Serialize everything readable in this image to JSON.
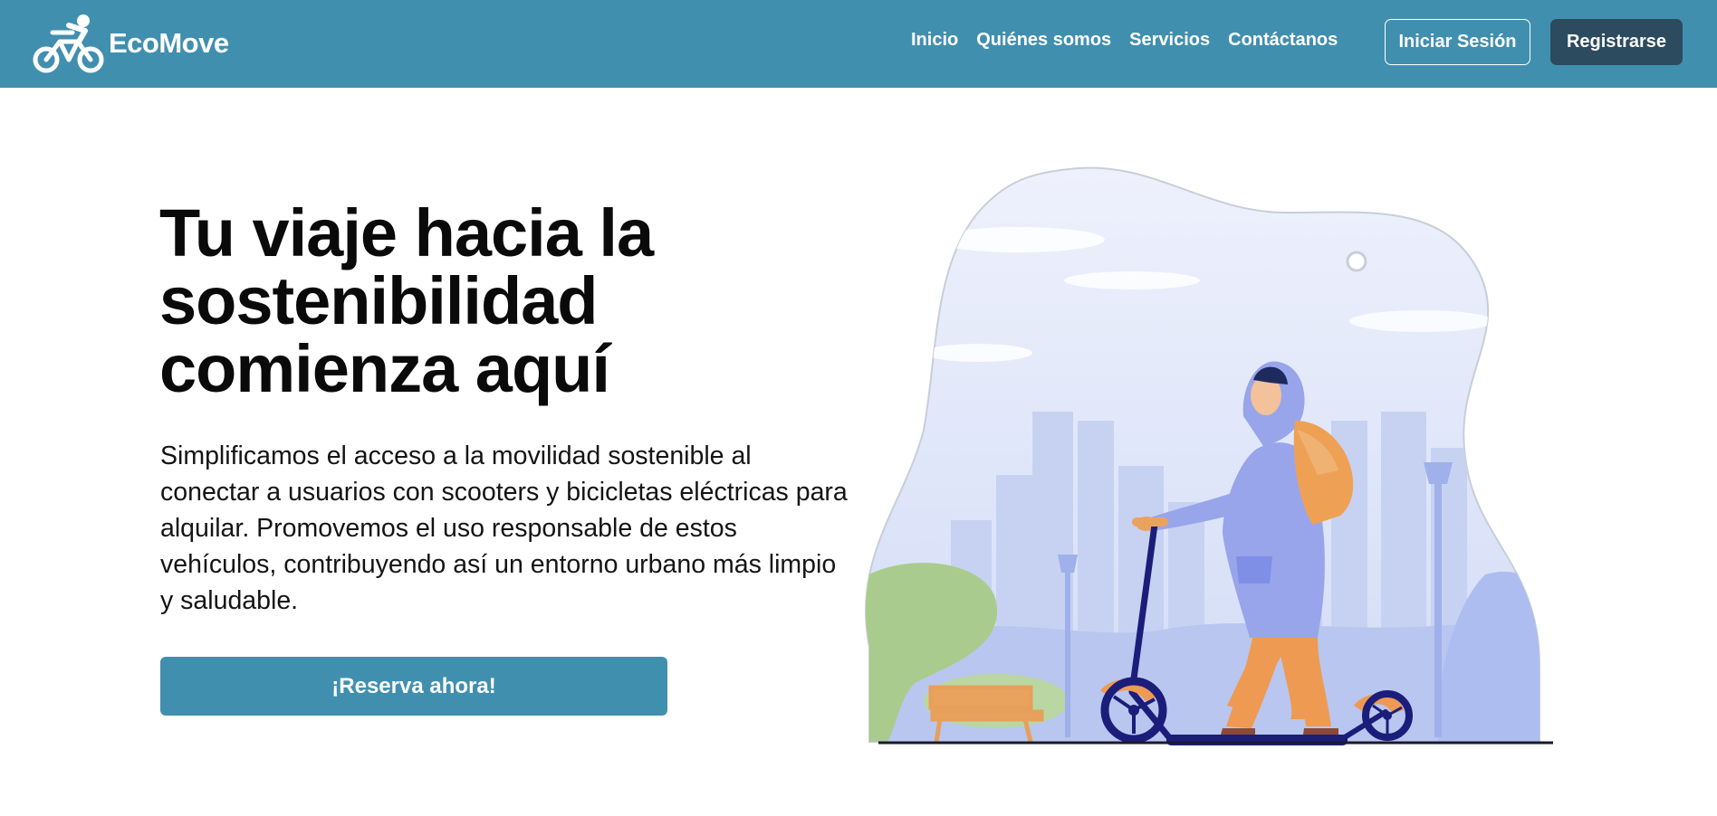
{
  "navbar": {
    "brand": "EcoMove",
    "logo_icon": "bike-rider-icon",
    "links": [
      "Inicio",
      "Quiénes somos",
      "Servicios",
      "Contáctanos"
    ],
    "login_label": "Iniciar Sesión",
    "register_label": "Registrarse"
  },
  "hero": {
    "title": "Tu viaje hacia la sostenibilidad comienza aquí",
    "description": "Simplificamos el acceso a la movilidad sostenible al conectar a usuarios con scooters y bicicletas eléctricas para alquilar. Promovemos el uso responsable de estos vehículos, contribuyendo así un entorno urbano más limpio y saludable.",
    "cta_label": "¡Reserva ahora!",
    "illustration": "person-riding-electric-scooter-illustration"
  },
  "colors": {
    "brand": "#418faf",
    "register_button": "#2c4b5f",
    "illustration_blob": "#dfe6fa",
    "scooter": "#1c1d7a",
    "accent_orange": "#ee9a52"
  }
}
